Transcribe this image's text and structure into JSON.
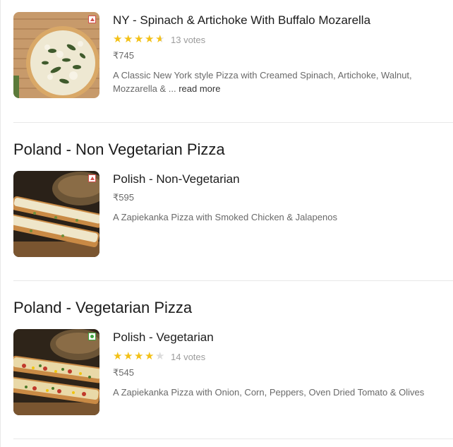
{
  "items": [
    {
      "name": "NY - Spinach & Artichoke With Buffalo Mozarella",
      "rating": 4.5,
      "votes": "13 votes",
      "price": "₹745",
      "description": "A Classic New York style Pizza with Creamed Spinach, Artichoke, Walnut, Mozzarella & ...",
      "read_more": "read more",
      "food_type": "non-veg",
      "image": "pizza-image"
    },
    {
      "name": "Polish - Non-Vegetarian",
      "price": "₹595",
      "description": "A Zapiekanka Pizza with Smoked Chicken & Jalapenos",
      "food_type": "non-veg",
      "image": "zapiekanka-image"
    },
    {
      "name": "Polish - Vegetarian",
      "rating": 4,
      "votes": "14 votes",
      "price": "₹545",
      "description": "A Zapiekanka Pizza with Onion, Corn, Peppers, Oven Dried Tomato & Olives",
      "food_type": "veg",
      "image": "zapiekanka-veg-image"
    }
  ],
  "sections": [
    {
      "title": "Poland - Non Vegetarian Pizza"
    },
    {
      "title": "Poland - Vegetarian Pizza"
    }
  ],
  "colors": {
    "star": "#f3c117",
    "star_empty": "#dcdcdc",
    "non_veg": "#d2504c",
    "veg": "#3fa33f"
  }
}
